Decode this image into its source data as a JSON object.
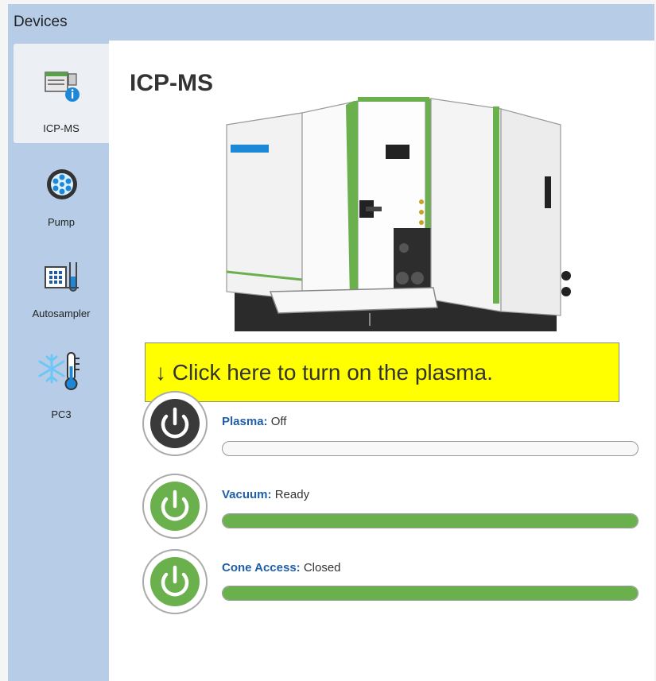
{
  "window": {
    "title": "Devices"
  },
  "sidebar": {
    "items": [
      {
        "label": "ICP-MS",
        "icon": "icpms-info-icon",
        "active": true
      },
      {
        "label": "Pump",
        "icon": "pump-icon",
        "active": false
      },
      {
        "label": "Autosampler",
        "icon": "autosampler-icon",
        "active": false
      },
      {
        "label": "PC3",
        "icon": "snowflake-thermometer-icon",
        "active": false
      }
    ]
  },
  "main": {
    "title": "ICP-MS",
    "callout": "↓ Click here to turn on the plasma.",
    "statuses": [
      {
        "name": "Plasma:",
        "value": "Off",
        "progress": 0,
        "button_state": "off"
      },
      {
        "name": "Vacuum:",
        "value": "Ready",
        "progress": 1,
        "button_state": "on"
      },
      {
        "name": "Cone Access:",
        "value": "Closed",
        "progress": 1,
        "button_state": "on"
      }
    ]
  },
  "colors": {
    "sidebar_bg": "#b7cde7",
    "active_item_bg": "#eceff3",
    "label_blue": "#1f5ea8",
    "progress_green": "#6ab04c",
    "callout_yellow": "#ffff00",
    "power_off": "#3a3a3a",
    "power_on": "#6ab04c"
  }
}
